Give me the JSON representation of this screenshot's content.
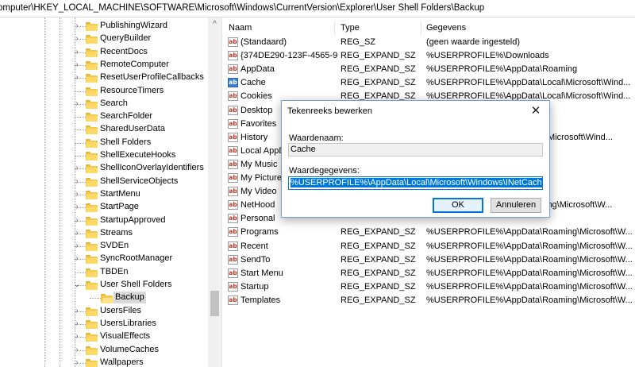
{
  "address": "omputer\\HKEY_LOCAL_MACHINE\\SOFTWARE\\Microsoft\\Windows\\CurrentVersion\\Explorer\\User Shell Folders\\Backup",
  "tree": {
    "items": [
      {
        "label": "PublishingWizard",
        "expandable": true
      },
      {
        "label": "QueryBuilder",
        "expandable": true
      },
      {
        "label": "RecentDocs",
        "expandable": true
      },
      {
        "label": "RemoteComputer",
        "expandable": true
      },
      {
        "label": "ResetUserProfileCallbacks",
        "expandable": true
      },
      {
        "label": "ResourceTimers",
        "expandable": false
      },
      {
        "label": "Search",
        "expandable": true
      },
      {
        "label": "SearchFolder",
        "expandable": false
      },
      {
        "label": "SharedUserData",
        "expandable": false
      },
      {
        "label": "Shell Folders",
        "expandable": false
      },
      {
        "label": "ShellExecuteHooks",
        "expandable": false
      },
      {
        "label": "ShellIconOverlayIdentifiers",
        "expandable": true
      },
      {
        "label": "ShellServiceObjects",
        "expandable": true
      },
      {
        "label": "StartMenu",
        "expandable": true
      },
      {
        "label": "StartPage",
        "expandable": true
      },
      {
        "label": "StartupApproved",
        "expandable": true
      },
      {
        "label": "Streams",
        "expandable": true
      },
      {
        "label": "SVDEn",
        "expandable": true
      },
      {
        "label": "SyncRootManager",
        "expandable": true
      },
      {
        "label": "TBDEn",
        "expandable": false
      },
      {
        "label": "User Shell Folders",
        "expandable": true,
        "expanded": true
      },
      {
        "label": "Backup",
        "child": true,
        "selected": true
      },
      {
        "label": "UsersFiles",
        "expandable": true
      },
      {
        "label": "UsersLibraries",
        "expandable": true
      },
      {
        "label": "VisualEffects",
        "expandable": true
      },
      {
        "label": "VolumeCaches",
        "expandable": true
      },
      {
        "label": "Wallpapers",
        "expandable": true
      }
    ]
  },
  "list": {
    "headers": {
      "name": "Naam",
      "type": "Type",
      "data": "Gegevens"
    },
    "rows": [
      {
        "name": "(Standaard)",
        "type": "REG_SZ",
        "data": "(geen waarde ingesteld)"
      },
      {
        "name": "{374DE290-123F-4565-9...",
        "type": "REG_EXPAND_SZ",
        "data": "%USERPROFILE%\\Downloads"
      },
      {
        "name": "AppData",
        "type": "REG_EXPAND_SZ",
        "data": "%USERPROFILE%\\AppData\\Roaming"
      },
      {
        "name": "Cache",
        "type": "REG_EXPAND_SZ",
        "data": "%USERPROFILE%\\AppData\\Local\\Microsoft\\Wind...",
        "selected": true
      },
      {
        "name": "Cookies",
        "type": "REG_EXPAND_SZ",
        "data": "%USERPROFILE%\\AppData\\Local\\Microsoft\\Wind..."
      },
      {
        "name": "Desktop",
        "type": "",
        "data": ""
      },
      {
        "name": "Favorites",
        "type": "",
        "data": ""
      },
      {
        "name": "History",
        "type": "",
        "data": "\\Microsoft\\Wind..."
      },
      {
        "name": "Local AppD",
        "type": "",
        "data": ""
      },
      {
        "name": "My Music",
        "type": "",
        "data": ""
      },
      {
        "name": "My Picture",
        "type": "",
        "data": ""
      },
      {
        "name": "My Video",
        "type": "",
        "data": ""
      },
      {
        "name": "NetHood",
        "type": "",
        "data": "ing\\Microsoft\\W..."
      },
      {
        "name": "Personal",
        "type": "",
        "data": ""
      },
      {
        "name": "Programs",
        "type": "REG_EXPAND_SZ",
        "data": "%USERPROFILE%\\AppData\\Roaming\\Microsoft\\W..."
      },
      {
        "name": "Recent",
        "type": "REG_EXPAND_SZ",
        "data": "%USERPROFILE%\\AppData\\Roaming\\Microsoft\\W..."
      },
      {
        "name": "SendTo",
        "type": "REG_EXPAND_SZ",
        "data": "%USERPROFILE%\\AppData\\Roaming\\Microsoft\\W..."
      },
      {
        "name": "Start Menu",
        "type": "REG_EXPAND_SZ",
        "data": "%USERPROFILE%\\AppData\\Roaming\\Microsoft\\W..."
      },
      {
        "name": "Startup",
        "type": "REG_EXPAND_SZ",
        "data": "%USERPROFILE%\\AppData\\Roaming\\Microsoft\\W..."
      },
      {
        "name": "Templates",
        "type": "REG_EXPAND_SZ",
        "data": "%USERPROFILE%\\AppData\\Roaming\\Microsoft\\W..."
      }
    ]
  },
  "dialog": {
    "title": "Tekenreeks bewerken",
    "close_symbol": "✕",
    "value_name_label": "Waardenaam:",
    "value_name": "Cache",
    "value_data_label": "Waardegegevens:",
    "value_data": "%USERPROFILE%\\AppData\\Local\\Microsoft\\Windows\\INetCache",
    "ok_label": "OK",
    "cancel_label": "Annuleren"
  },
  "icons": {
    "string_value": "ab",
    "expand": "›",
    "collapse": "⌄",
    "scroll_up": "^"
  },
  "colors": {
    "accent": "#0078d7",
    "folder": "#f3c94b",
    "selection": "#d9d9d9"
  }
}
